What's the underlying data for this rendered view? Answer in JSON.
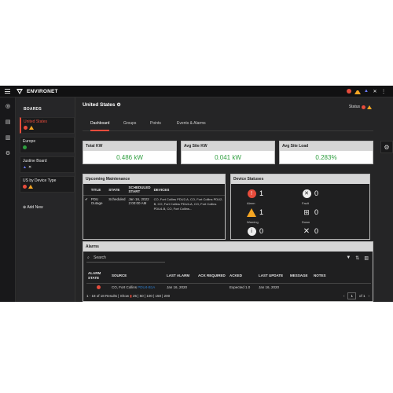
{
  "app": {
    "brand": "ENVIRONET"
  },
  "boards_panel": {
    "title": "BOARDS",
    "items": [
      {
        "label": "United States"
      },
      {
        "label": "Europe"
      },
      {
        "label": "Justine Board"
      },
      {
        "label": "US by Device Type"
      }
    ],
    "add_label": "Add New"
  },
  "page": {
    "title": "United States",
    "status_label": "Status"
  },
  "tabs": [
    "Dashboard",
    "Groups",
    "Points",
    "Events & Alarms"
  ],
  "kpis": [
    {
      "label": "Total KW",
      "value": "0.486 kW"
    },
    {
      "label": "Avg Site KW",
      "value": "0.041 kW"
    },
    {
      "label": "Avg Site Load",
      "value": "0.283%"
    }
  ],
  "maintenance": {
    "title": "Upcoming Maintenance",
    "columns": [
      "TITLE",
      "STATE",
      "SCHEDULED START",
      "DEVICES"
    ],
    "row": {
      "title": "PDU Outage",
      "state": "Scheduled",
      "start": "Jan 16, 2022 2:00:00 AM",
      "devices": "CO, Fort Collins PDU2-A, CO, Fort Collins PDU2-B, CO, Fort Collins PDU4-A, CO, Fort Collins PDU4-B, CO, Fort Collins..."
    }
  },
  "device_statuses": {
    "title": "Device Statuses",
    "items": [
      {
        "label": "Alarm",
        "count": "1"
      },
      {
        "label": "Fault",
        "count": "0"
      },
      {
        "label": "Warning",
        "count": "1"
      },
      {
        "label": "Down",
        "count": "0"
      },
      {
        "label": "Info",
        "count": "0"
      },
      {
        "label": "Maintenance",
        "count": "0"
      }
    ]
  },
  "alarms": {
    "title": "Alarms",
    "search_placeholder": "Search",
    "columns": [
      "ALARM STATE",
      "SOURCE",
      "LAST ALARM",
      "ACK REQUIRED",
      "ACKED",
      "LAST UPDATE",
      "MESSAGE",
      "NOTES"
    ],
    "row": {
      "source": "CO, Fort Collins",
      "source_link": "PDU4-B1A",
      "last_alarm": "Jan 16, 2020",
      "acked": "Expected 1.0",
      "last_update": "Jan 16, 2020"
    },
    "results_text": "1 - 18 of 18 Results | Show",
    "page_sizes": "25 | 50 | 100 | 150 | 200",
    "page_current": "1",
    "page_of": "of 1"
  },
  "colors": {
    "accent": "#e74c3c",
    "good": "#2e9e3e",
    "warn": "#f5a623",
    "link": "#2d7fd0"
  }
}
